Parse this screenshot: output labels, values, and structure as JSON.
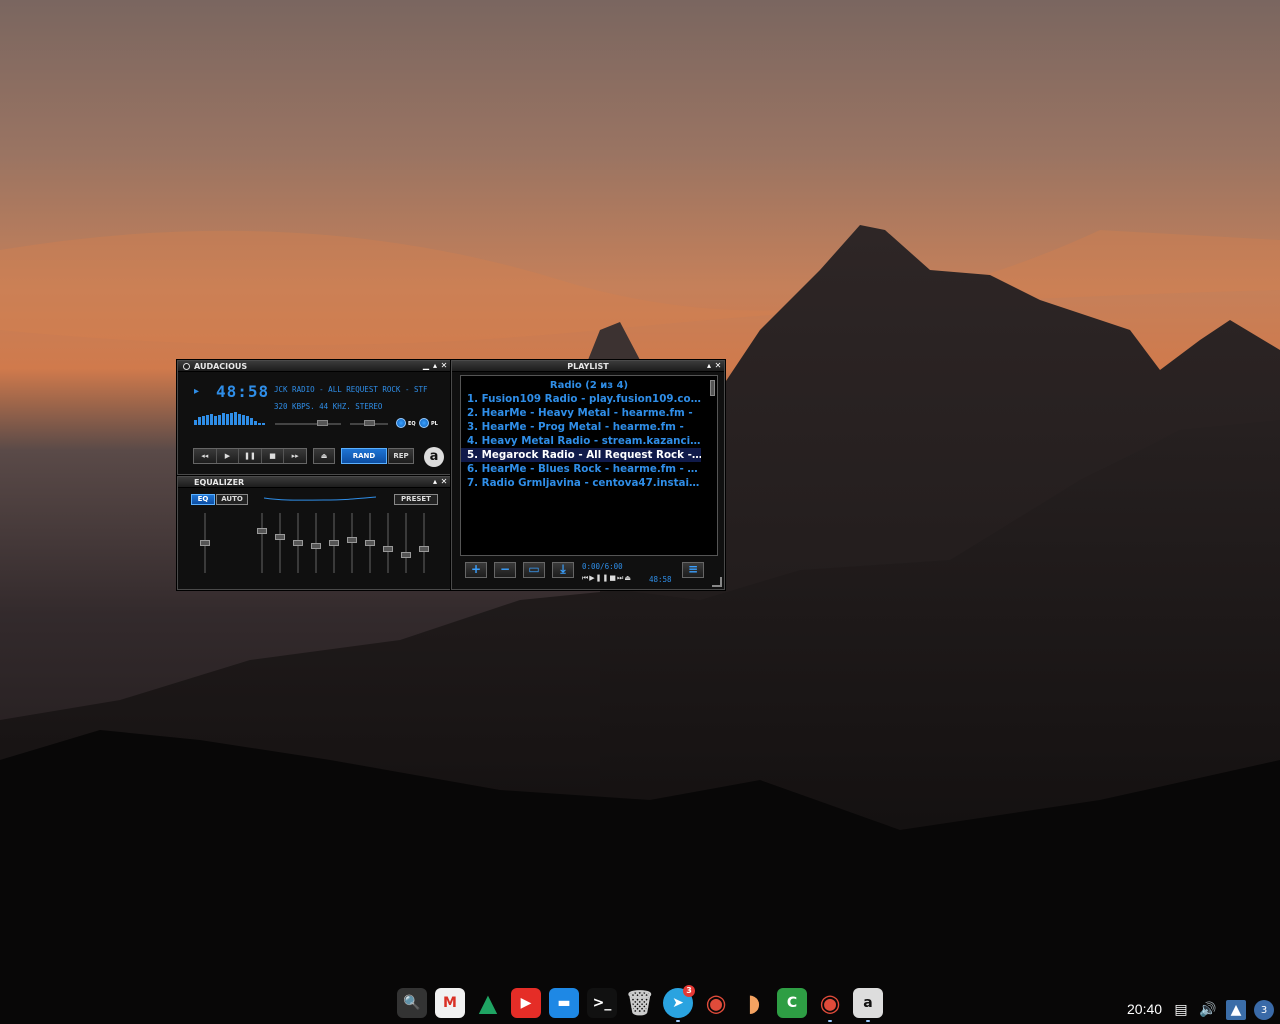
{
  "main": {
    "title": "AUDACIOUS",
    "time": "48:58",
    "song_ticker": "JCK RADIO - ALL REQUEST ROCK - STF",
    "stream_info": "320 KBPS. 44 KHZ. STEREO",
    "eq_toggle": "EQ",
    "pl_toggle": "PL",
    "rand": "RAND",
    "rep": "REP",
    "logo_letter": "a",
    "transport": {
      "prev": "◂◂",
      "play": "▶",
      "pause": "❚❚",
      "stop": "■",
      "next": "▸▸",
      "eject": "⏏"
    }
  },
  "equalizer": {
    "title": "EQUALIZER",
    "eq_button": "EQ",
    "auto_button": "AUTO",
    "preset_button": "PRESET",
    "levels": [
      0,
      0.2,
      0.1,
      0,
      -0.05,
      0,
      0.05,
      0,
      -0.1,
      -0.2,
      -0.1,
      0.15
    ]
  },
  "playlist": {
    "title": "PLAYLIST",
    "header": "Radio (2 из 4)",
    "items": [
      "1. Fusion109 Radio - play.fusion109.co…",
      "2. HearMe - Heavy Metal - hearme.fm -",
      "3. HearMe - Prog Metal - hearme.fm -",
      "4. Heavy Metal Radio - stream.kazanci…",
      "5. Megarock Radio - All Request Rock -…",
      "6. HearMe - Blues Rock - hearme.fm - …",
      "7. Radio Grmljavina - centova47.instai…"
    ],
    "current_index": 4,
    "position": "0:00/6:00",
    "elapsed": "48:58",
    "mini_controls": "⏮▶❚❚■⏭⏏",
    "buttons": {
      "add": "+",
      "remove": "−",
      "select": "▭",
      "misc": "⤓",
      "list": "≡"
    }
  },
  "shelf": {
    "items": [
      {
        "name": "launcher-search-icon",
        "glyph": "🔍",
        "bg": "#333333",
        "fg": "#ffffff"
      },
      {
        "name": "gmail-icon",
        "glyph": "M",
        "bg": "#f1f1f1",
        "fg": "#d93025"
      },
      {
        "name": "google-drive-icon",
        "glyph": "▲",
        "bg": "transparent",
        "fg": "#1fa463"
      },
      {
        "name": "youtube-icon",
        "glyph": "▶",
        "bg": "#e52d27",
        "fg": "#ffffff"
      },
      {
        "name": "files-icon",
        "glyph": "▬",
        "bg": "#1e88e5",
        "fg": "#ffffff"
      },
      {
        "name": "terminal-icon",
        "glyph": ">_",
        "bg": "#111111",
        "fg": "#ffffff"
      },
      {
        "name": "trash-icon",
        "glyph": "🗑",
        "bg": "transparent",
        "fg": "#cccccc"
      },
      {
        "name": "telegram-icon",
        "glyph": "➤",
        "bg": "#2aa3e0",
        "fg": "#ffffff"
      },
      {
        "name": "chrome-icon",
        "glyph": "◉",
        "bg": "transparent",
        "fg": "#e04b3a"
      },
      {
        "name": "melon-icon",
        "glyph": "◗",
        "bg": "transparent",
        "fg": "#f4a261"
      },
      {
        "name": "green-app-icon",
        "glyph": "C",
        "bg": "#2e9e44",
        "fg": "#ffffff"
      },
      {
        "name": "chrome-2-icon",
        "glyph": "◉",
        "bg": "transparent",
        "fg": "#e04b3a"
      },
      {
        "name": "audacious-icon",
        "glyph": "a",
        "bg": "#dddddd",
        "fg": "#111111"
      }
    ],
    "telegram_badge": "3"
  },
  "tray": {
    "clock": "20:40",
    "notification_count": "3"
  }
}
